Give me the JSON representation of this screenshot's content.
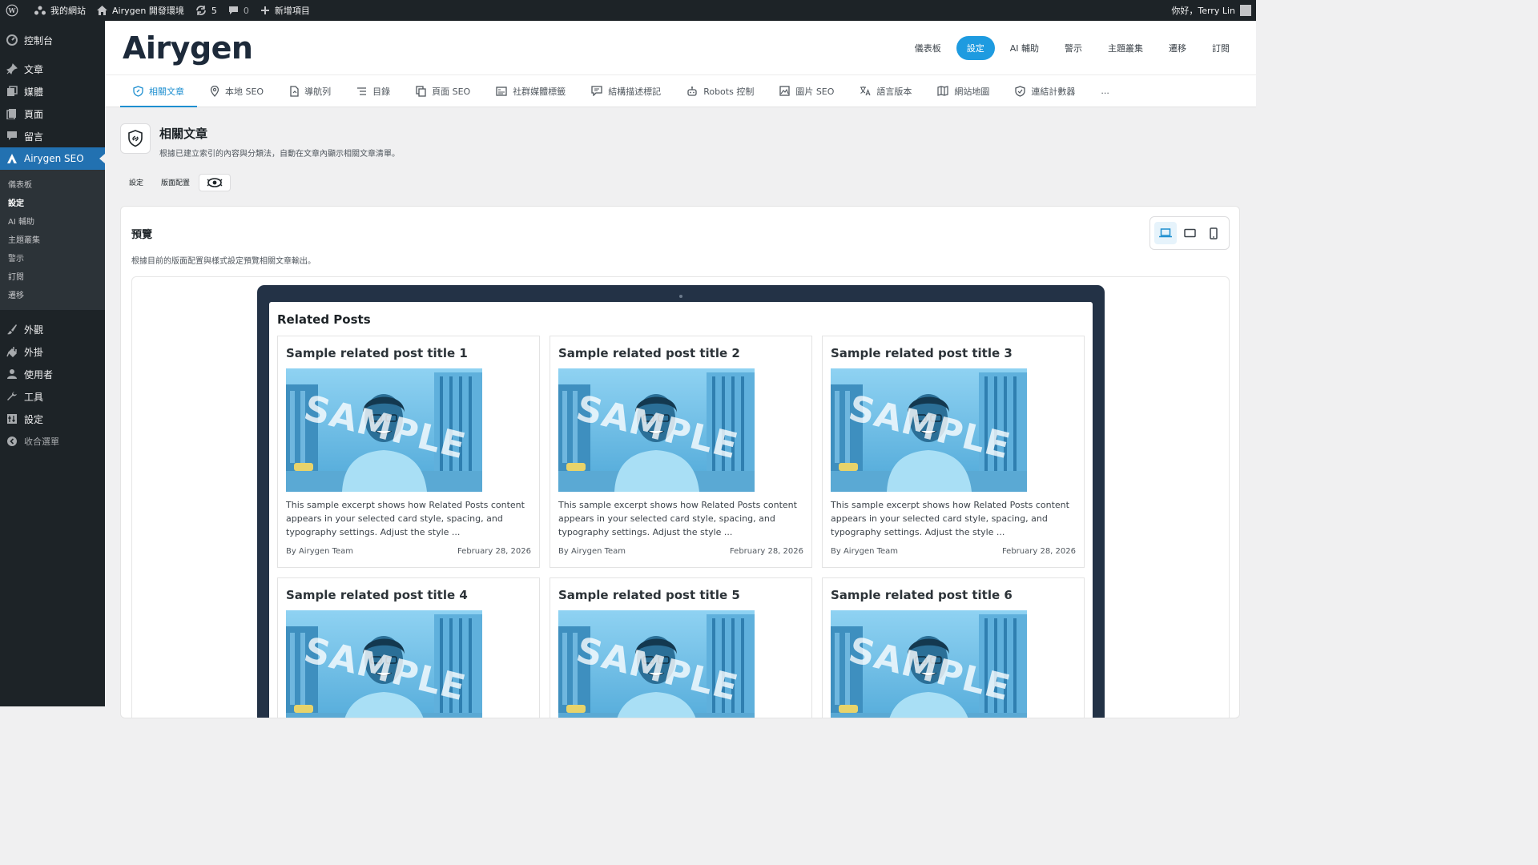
{
  "admin_bar": {
    "site_name": "我的網站",
    "env_name": "Airygen 開發環境",
    "updates_count": "5",
    "comments_count": "0",
    "new_item": "新增項目",
    "greeting": "你好，Terry Lin"
  },
  "sidebar": {
    "items": [
      {
        "label": "控制台",
        "icon": "dashboard-icon"
      },
      {
        "label": "文章",
        "icon": "pin-icon"
      },
      {
        "label": "媒體",
        "icon": "media-icon"
      },
      {
        "label": "頁面",
        "icon": "page-icon"
      },
      {
        "label": "留言",
        "icon": "comment-icon"
      },
      {
        "label": "Airygen SEO",
        "icon": "airygen-icon"
      },
      {
        "label": "外觀",
        "icon": "brush-icon"
      },
      {
        "label": "外掛",
        "icon": "plugin-icon"
      },
      {
        "label": "使用者",
        "icon": "user-icon"
      },
      {
        "label": "工具",
        "icon": "wrench-icon"
      },
      {
        "label": "設定",
        "icon": "settings-icon"
      },
      {
        "label": "收合選單",
        "icon": "collapse-icon"
      }
    ],
    "submenu": [
      "儀表板",
      "設定",
      "AI 輔助",
      "主題叢集",
      "警示",
      "訂閱",
      "遷移"
    ]
  },
  "header": {
    "logo": "Airygen",
    "topnav": [
      "儀表板",
      "設定",
      "AI 輔助",
      "警示",
      "主題叢集",
      "遷移",
      "訂閱"
    ],
    "active_topnav": "設定"
  },
  "tabs": [
    {
      "label": "相關文章",
      "icon": "shield-link-icon"
    },
    {
      "label": "本地 SEO",
      "icon": "map-pin-icon"
    },
    {
      "label": "導航列",
      "icon": "document-icon"
    },
    {
      "label": "目錄",
      "icon": "list-icon"
    },
    {
      "label": "頁面 SEO",
      "icon": "pages-icon"
    },
    {
      "label": "社群媒體標籤",
      "icon": "card-icon"
    },
    {
      "label": "結構描述標記",
      "icon": "message-icon"
    },
    {
      "label": "Robots 控制",
      "icon": "robot-icon"
    },
    {
      "label": "圖片 SEO",
      "icon": "image-icon"
    },
    {
      "label": "語言版本",
      "icon": "translate-icon"
    },
    {
      "label": "網站地圖",
      "icon": "map-icon"
    },
    {
      "label": "連結計數器",
      "icon": "shield-icon"
    },
    {
      "label": "...",
      "icon": "more-icon"
    }
  ],
  "page": {
    "title": "相關文章",
    "description": "根據已建立索引的內容與分類法，自動在文章內顯示相關文章清單。",
    "subtabs": [
      "設定",
      "版面配置"
    ]
  },
  "preview": {
    "title": "預覽",
    "description": "根據目前的版面配置與樣式設定預覽相關文章輸出。",
    "heading": "Related Posts",
    "image_watermark": "SAMPLE",
    "cards": [
      {
        "title": "Sample related post title 1",
        "excerpt": "This sample excerpt shows how Related Posts content appears in your selected card style, spacing, and typography settings. Adjust the style ...",
        "author": "By Airygen Team",
        "date": "February 28, 2026"
      },
      {
        "title": "Sample related post title 2",
        "excerpt": "This sample excerpt shows how Related Posts content appears in your selected card style, spacing, and typography settings. Adjust the style ...",
        "author": "By Airygen Team",
        "date": "February 28, 2026"
      },
      {
        "title": "Sample related post title 3",
        "excerpt": "This sample excerpt shows how Related Posts content appears in your selected card style, spacing, and typography settings. Adjust the style ...",
        "author": "By Airygen Team",
        "date": "February 28, 2026"
      },
      {
        "title": "Sample related post title 4",
        "excerpt": "",
        "author": "",
        "date": ""
      },
      {
        "title": "Sample related post title 5",
        "excerpt": "",
        "author": "",
        "date": ""
      },
      {
        "title": "Sample related post title 6",
        "excerpt": "",
        "author": "",
        "date": ""
      }
    ]
  },
  "colors": {
    "admin_dark": "#1d2327",
    "accent_blue": "#1e9be0",
    "wp_blue": "#2271b1",
    "laptop_frame": "#233246"
  }
}
